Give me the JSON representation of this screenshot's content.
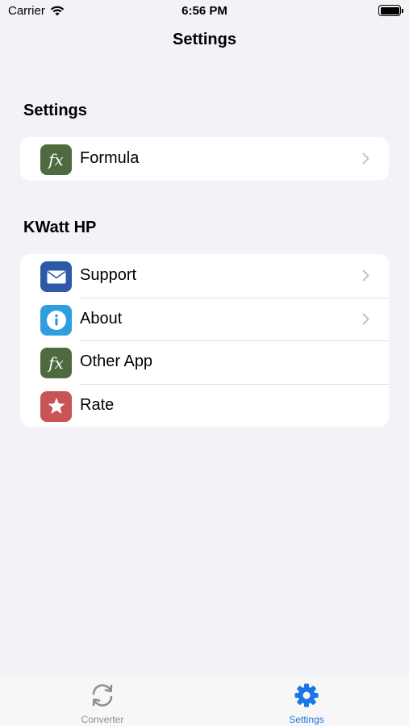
{
  "status_bar": {
    "carrier": "Carrier",
    "time": "6:56 PM"
  },
  "nav": {
    "title": "Settings"
  },
  "sections": [
    {
      "header": "Settings",
      "rows": [
        {
          "label": "Formula",
          "icon": "fx-icon",
          "color": "#4e6b40",
          "chevron": true
        }
      ]
    },
    {
      "header": "KWatt HP",
      "rows": [
        {
          "label": "Support",
          "icon": "envelope-icon",
          "color": "#2d5aa8",
          "chevron": true
        },
        {
          "label": "About",
          "icon": "info-icon",
          "color": "#2f9ee0",
          "chevron": true
        },
        {
          "label": "Other App",
          "icon": "fx-icon",
          "color": "#4e6b40",
          "chevron": false
        },
        {
          "label": "Rate",
          "icon": "star-icon",
          "color": "#c95455",
          "chevron": false
        }
      ]
    }
  ],
  "tabs": [
    {
      "label": "Converter",
      "icon": "refresh-icon",
      "color": "#8e8e93"
    },
    {
      "label": "Settings",
      "icon": "gear-icon",
      "color": "#1877e8"
    }
  ]
}
